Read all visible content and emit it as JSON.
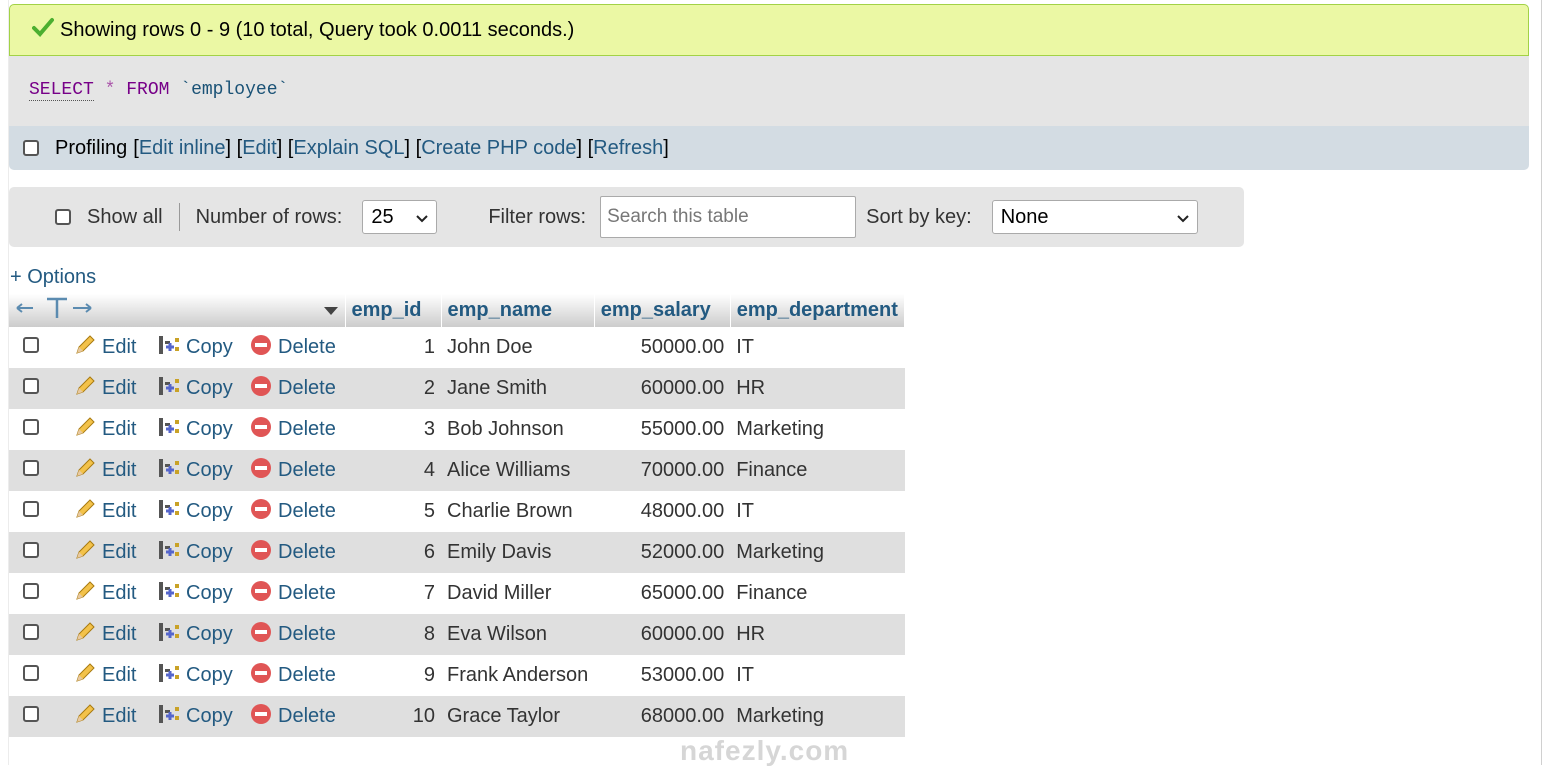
{
  "status": {
    "message": "Showing rows 0 - 9 (10 total, Query took 0.0011 seconds.)"
  },
  "query": {
    "keyword_select": "SELECT",
    "star": "*",
    "keyword_from": "FROM",
    "table": "`employee`"
  },
  "toolbar": {
    "profiling_label": "Profiling",
    "links": [
      "Edit inline",
      "Edit",
      "Explain SQL",
      "Create PHP code",
      "Refresh"
    ]
  },
  "navigation": {
    "show_all_label": "Show all",
    "rows_label": "Number of rows:",
    "rows_value": "25",
    "filter_label": "Filter rows:",
    "filter_placeholder": "Search this table",
    "sort_label": "Sort by key:",
    "sort_value": "None"
  },
  "options_label": "+ Options",
  "table": {
    "columns": [
      "emp_id",
      "emp_name",
      "emp_salary",
      "emp_department"
    ],
    "action_labels": {
      "edit": "Edit",
      "copy": "Copy",
      "delete": "Delete"
    },
    "rows": [
      [
        "1",
        "John Doe",
        "50000.00",
        "IT"
      ],
      [
        "2",
        "Jane Smith",
        "60000.00",
        "HR"
      ],
      [
        "3",
        "Bob Johnson",
        "55000.00",
        "Marketing"
      ],
      [
        "4",
        "Alice Williams",
        "70000.00",
        "Finance"
      ],
      [
        "5",
        "Charlie Brown",
        "48000.00",
        "IT"
      ],
      [
        "6",
        "Emily Davis",
        "52000.00",
        "Marketing"
      ],
      [
        "7",
        "David Miller",
        "65000.00",
        "Finance"
      ],
      [
        "8",
        "Eva Wilson",
        "60000.00",
        "HR"
      ],
      [
        "9",
        "Frank Anderson",
        "53000.00",
        "IT"
      ],
      [
        "10",
        "Grace Taylor",
        "68000.00",
        "Marketing"
      ]
    ]
  },
  "watermark": "nafezly.com",
  "colors": {
    "link": "#235a81",
    "success_bg": "#ebf8a4",
    "row_alt": "#dfdfdf",
    "toolbar_bg": "#d3dce3"
  }
}
